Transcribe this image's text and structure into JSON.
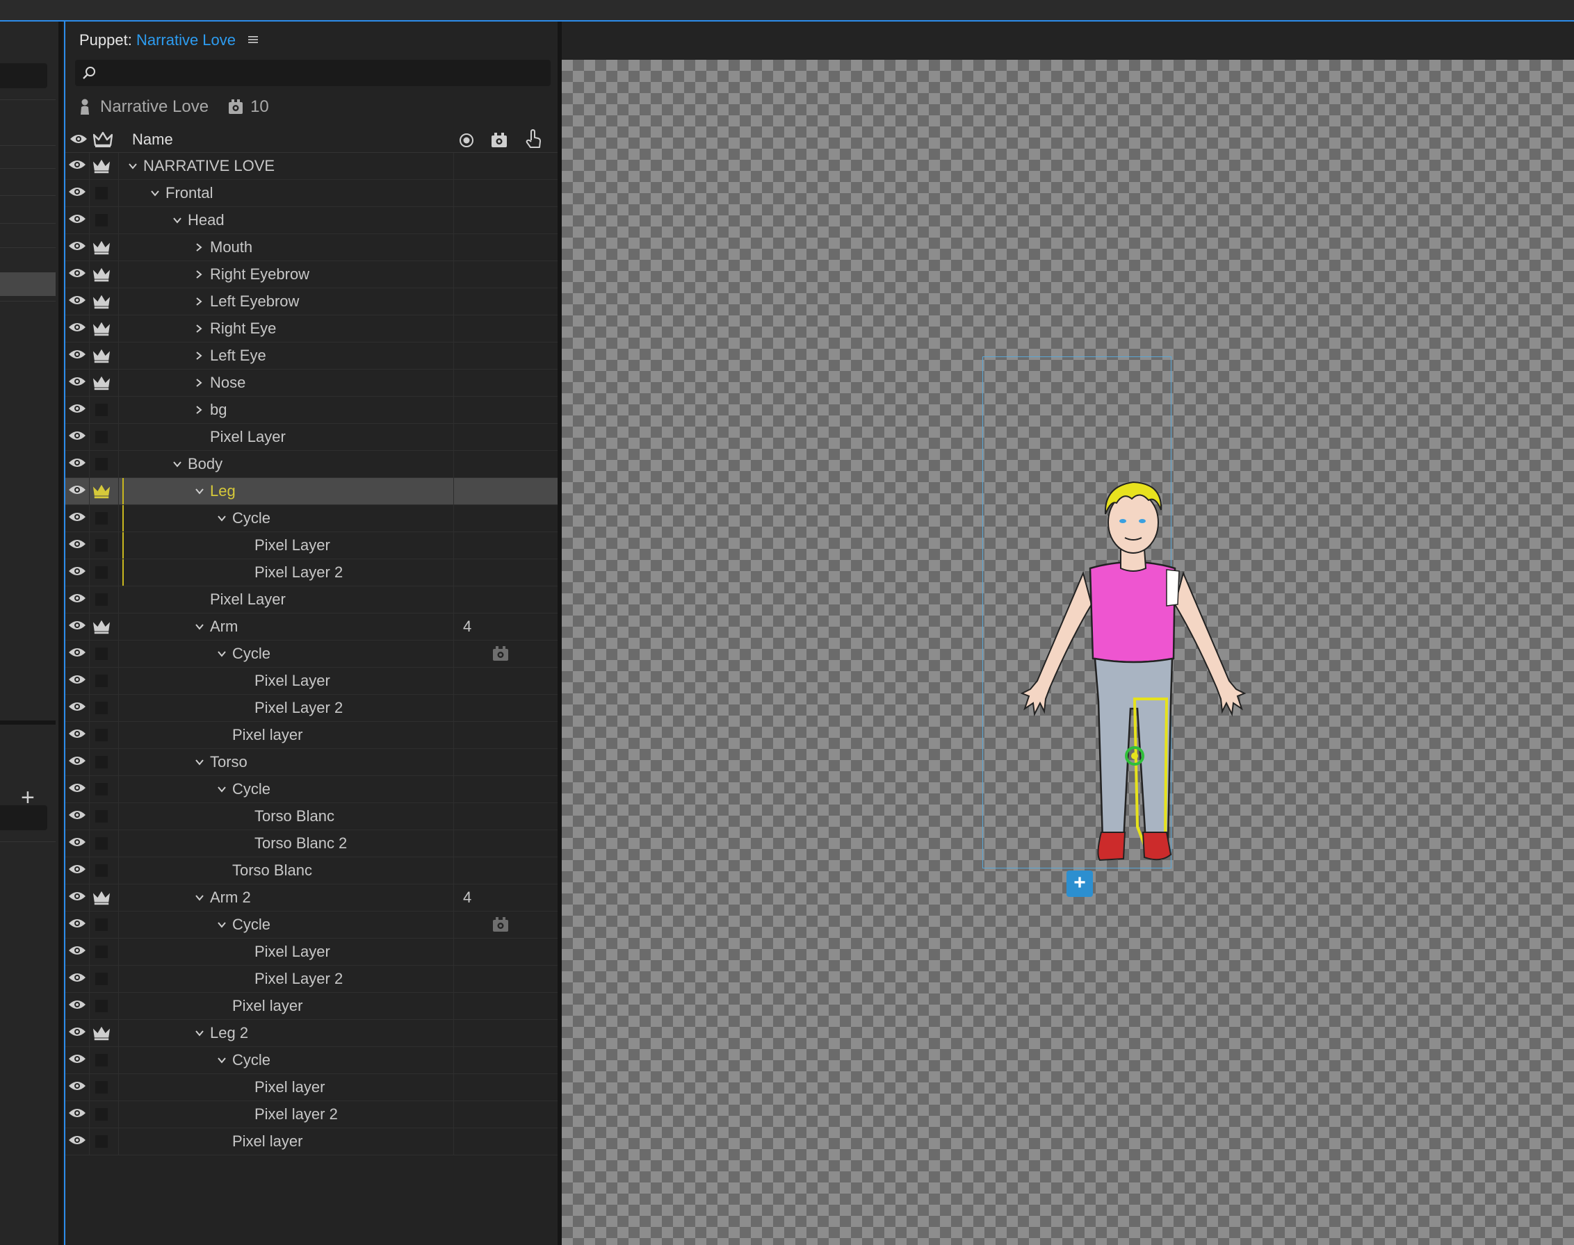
{
  "panel": {
    "title_prefix": "Puppet: ",
    "title_name": "Narrative Love",
    "menu_icon": "hamburger-menu-icon"
  },
  "search": {
    "placeholder": ""
  },
  "puppet_info": {
    "name": "Narrative Love",
    "cycle_count": "10"
  },
  "columns": {
    "name": "Name"
  },
  "colors": {
    "accent": "#2d9cf0",
    "selected_text": "#d6c93a",
    "crown_selected": "#d6c93a",
    "handle_green": "#2fbf3a"
  },
  "layers": [
    {
      "label": "NARRATIVE LOVE",
      "depth": 0,
      "chev": "down",
      "crown": true
    },
    {
      "label": "Frontal",
      "depth": 1,
      "chev": "down",
      "crown": false
    },
    {
      "label": "Head",
      "depth": 2,
      "chev": "down",
      "crown": false
    },
    {
      "label": "Mouth",
      "depth": 3,
      "chev": "right",
      "crown": true
    },
    {
      "label": "Right Eyebrow",
      "depth": 3,
      "chev": "right",
      "crown": true
    },
    {
      "label": "Left Eyebrow",
      "depth": 3,
      "chev": "right",
      "crown": true
    },
    {
      "label": "Right Eye",
      "depth": 3,
      "chev": "right",
      "crown": true
    },
    {
      "label": "Left Eye",
      "depth": 3,
      "chev": "right",
      "crown": true
    },
    {
      "label": "Nose",
      "depth": 3,
      "chev": "right",
      "crown": true
    },
    {
      "label": "bg",
      "depth": 3,
      "chev": "right",
      "crown": false
    },
    {
      "label": "Pixel Layer",
      "depth": 3,
      "chev": "none",
      "crown": false
    },
    {
      "label": "Body",
      "depth": 2,
      "chev": "down",
      "crown": false
    },
    {
      "label": "Leg",
      "depth": 3,
      "chev": "down",
      "crown": true,
      "selected": true,
      "yline": true
    },
    {
      "label": "Cycle",
      "depth": 4,
      "chev": "down",
      "crown": false,
      "yline": true
    },
    {
      "label": "Pixel Layer",
      "depth": 5,
      "chev": "none",
      "crown": false,
      "yline": true
    },
    {
      "label": "Pixel Layer 2",
      "depth": 5,
      "chev": "none",
      "crown": false,
      "yline": true
    },
    {
      "label": "Pixel Layer",
      "depth": 3,
      "chev": "none",
      "crown": false
    },
    {
      "label": "Arm",
      "depth": 3,
      "chev": "down",
      "crown": true,
      "num": "4"
    },
    {
      "label": "Cycle",
      "depth": 4,
      "chev": "down",
      "crown": false,
      "cycle_icon": true
    },
    {
      "label": "Pixel Layer",
      "depth": 5,
      "chev": "none",
      "crown": false
    },
    {
      "label": "Pixel Layer 2",
      "depth": 5,
      "chev": "none",
      "crown": false
    },
    {
      "label": "Pixel layer",
      "depth": 4,
      "chev": "none",
      "crown": false
    },
    {
      "label": "Torso",
      "depth": 3,
      "chev": "down",
      "crown": false
    },
    {
      "label": "Cycle",
      "depth": 4,
      "chev": "down",
      "crown": false
    },
    {
      "label": "Torso Blanc",
      "depth": 5,
      "chev": "none",
      "crown": false
    },
    {
      "label": "Torso Blanc 2",
      "depth": 5,
      "chev": "none",
      "crown": false
    },
    {
      "label": "Torso Blanc",
      "depth": 4,
      "chev": "none",
      "crown": false
    },
    {
      "label": "Arm 2",
      "depth": 3,
      "chev": "down",
      "crown": true,
      "num": "4"
    },
    {
      "label": "Cycle",
      "depth": 4,
      "chev": "down",
      "crown": false,
      "cycle_icon": true
    },
    {
      "label": "Pixel Layer",
      "depth": 5,
      "chev": "none",
      "crown": false
    },
    {
      "label": "Pixel Layer 2",
      "depth": 5,
      "chev": "none",
      "crown": false
    },
    {
      "label": "Pixel layer",
      "depth": 4,
      "chev": "none",
      "crown": false
    },
    {
      "label": "Leg 2",
      "depth": 3,
      "chev": "down",
      "crown": true
    },
    {
      "label": "Cycle",
      "depth": 4,
      "chev": "down",
      "crown": false
    },
    {
      "label": "Pixel layer",
      "depth": 5,
      "chev": "none",
      "crown": false
    },
    {
      "label": "Pixel layer 2",
      "depth": 5,
      "chev": "none",
      "crown": false
    },
    {
      "label": "Pixel layer",
      "depth": 4,
      "chev": "none",
      "crown": false
    }
  ],
  "canvas": {
    "add_button": "+"
  },
  "left_strip": {
    "add_label": "+"
  }
}
